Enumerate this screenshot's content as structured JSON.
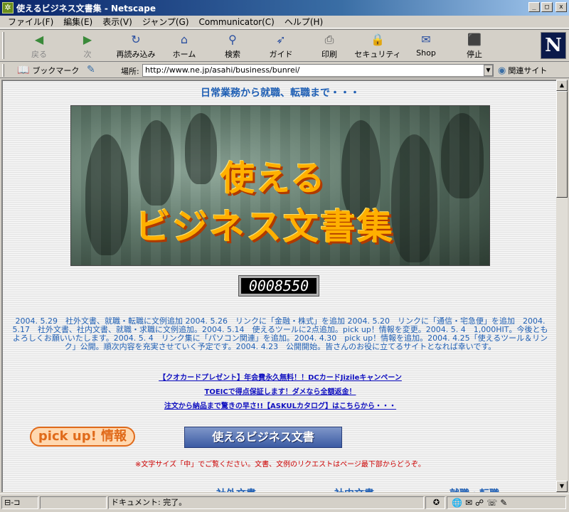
{
  "window": {
    "title": "使えるビジネス文書集 - Netscape",
    "min_label": "_",
    "max_label": "□",
    "close_label": "x"
  },
  "menu": [
    "ファイル(F)",
    "編集(E)",
    "表示(V)",
    "ジャンプ(G)",
    "Communicator(C)",
    "ヘルプ(H)"
  ],
  "toolbar": [
    {
      "label": "戻る",
      "icon": "back-icon",
      "glyph": "◀",
      "disabled": true
    },
    {
      "label": "次",
      "icon": "forward-icon",
      "glyph": "▶",
      "disabled": true
    },
    {
      "label": "再読み込み",
      "icon": "reload-icon",
      "glyph": "↻",
      "disabled": false
    },
    {
      "label": "ホーム",
      "icon": "home-icon",
      "glyph": "⌂",
      "disabled": false
    },
    {
      "label": "検索",
      "icon": "search-icon",
      "glyph": "⚲",
      "disabled": false
    },
    {
      "label": "ガイド",
      "icon": "guide-icon",
      "glyph": "➶",
      "disabled": false
    },
    {
      "label": "印刷",
      "icon": "print-icon",
      "glyph": "⎙",
      "disabled": false
    },
    {
      "label": "セキュリティ",
      "icon": "lock-icon",
      "glyph": "🔒",
      "disabled": false
    },
    {
      "label": "Shop",
      "icon": "shop-icon",
      "glyph": "✉",
      "disabled": false
    },
    {
      "label": "停止",
      "icon": "stop-icon",
      "glyph": "⬛",
      "disabled": false
    }
  ],
  "logo": "N",
  "location": {
    "bookmark_label": "ブックマーク",
    "location_label": "場所:",
    "url": "http://www.ne.jp/asahi/business/bunrei/",
    "related_label": "関連サイト"
  },
  "page": {
    "tagline": "日常業務から就職、転職まで・・・",
    "banner_line1": "使える",
    "banner_line2": "ビジネス文書集",
    "counter": "0008550",
    "news": "2004. 5.29　社外文書、就職・転職に文例追加 2004. 5.26　リンクに「金融・株式」を追加 2004. 5.20　リンクに「通信・宅急便」を追加　2004. 5.17　社外文書、社内文書、就職・求職に文例追加。2004. 5.14　使えるツールに2点追加。pick up！情報を変更。2004. 5. 4　1,000HIT。今後ともよろしくお願いいたします。2004. 5. 4　リンク集に「パソコン関連」を追加。2004. 4.30　pick up！情報を追加。2004. 4.25「使えるツール＆リンク」公開。順次内容を充実させていく予定です。2004. 4.23　公開開始。皆さんのお役に立てるサイトとなれば幸いです。",
    "promos": [
      "【クオカードプレゼント】年会費永久無料！！DCカードJizileキャンペーン",
      "TOEICで得点保証します！ダメなら全額返金！",
      "注文から納品まで驚きの早さ!!【ASKULカタログ】はこちらから・・・"
    ],
    "pickup_label": "pick up! 情報",
    "business_button": "使えるビジネス文書",
    "note": "※文字サイズ「中」でご覧ください。文書、文例のリクエストはページ最下部からどうぞ。",
    "categories": [
      "社外文書",
      "社内文書",
      "就職・転職"
    ]
  },
  "status": {
    "message": "ドキュメント: 完了。"
  }
}
